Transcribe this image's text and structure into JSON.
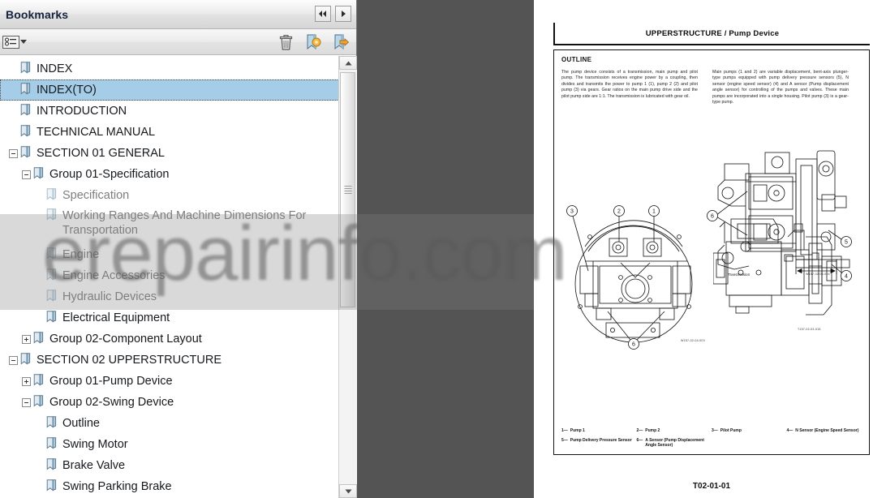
{
  "panel": {
    "title": "Bookmarks",
    "nav": {
      "prev_label": "◀◀",
      "next_label": "▶"
    },
    "toolbar": {
      "options_label": "Options",
      "delete_label": "Delete",
      "new_bookmark_label": "New Bookmark",
      "goto_bookmark_label": "Go To Bookmark"
    }
  },
  "tree": {
    "items": [
      {
        "label": "INDEX",
        "level": 0,
        "expander": "none",
        "state": "normal"
      },
      {
        "label": "INDEX(TO)",
        "level": 0,
        "expander": "none",
        "state": "selected"
      },
      {
        "label": "INTRODUCTION",
        "level": 0,
        "expander": "none",
        "state": "normal"
      },
      {
        "label": "TECHNICAL MANUAL",
        "level": 0,
        "expander": "none",
        "state": "normal"
      },
      {
        "label": "SECTION 01 GENERAL",
        "level": 0,
        "expander": "minus",
        "state": "normal"
      },
      {
        "label": "Group 01-Specification",
        "level": 1,
        "expander": "minus",
        "state": "normal"
      },
      {
        "label": "Specification",
        "level": 2,
        "expander": "none",
        "state": "dim"
      },
      {
        "label": "Working Ranges And Machine Dimensions For Transportation",
        "level": 2,
        "expander": "none",
        "state": "dim",
        "wrap": true
      },
      {
        "label": "Engine",
        "level": 2,
        "expander": "none",
        "state": "dim"
      },
      {
        "label": "Engine Accessories",
        "level": 2,
        "expander": "none",
        "state": "dim"
      },
      {
        "label": "Hydraulic Devices",
        "level": 2,
        "expander": "none",
        "state": "dim"
      },
      {
        "label": "Electrical Equipment",
        "level": 2,
        "expander": "none",
        "state": "normal"
      },
      {
        "label": "Group 02-Component Layout",
        "level": 1,
        "expander": "plus",
        "state": "normal"
      },
      {
        "label": "SECTION 02 UPPERSTRUCTURE",
        "level": 0,
        "expander": "minus",
        "state": "normal"
      },
      {
        "label": "Group 01-Pump Device",
        "level": 1,
        "expander": "plus",
        "state": "normal"
      },
      {
        "label": "Group 02-Swing Device",
        "level": 1,
        "expander": "minus",
        "state": "normal"
      },
      {
        "label": "Outline",
        "level": 2,
        "expander": "none",
        "state": "normal"
      },
      {
        "label": "Swing Motor",
        "level": 2,
        "expander": "none",
        "state": "normal"
      },
      {
        "label": "Brake Valve",
        "level": 2,
        "expander": "none",
        "state": "normal"
      },
      {
        "label": "Swing Parking Brake",
        "level": 2,
        "expander": "none",
        "state": "normal"
      }
    ]
  },
  "document": {
    "header_title": "UPPERSTRUCTURE / Pump Device",
    "section_heading": "OUTLINE",
    "column_left": "The pump device consists of a transmission, main pump and pilot pump. The transmission receives engine power by a coupling, then divides and transmits the power to pump 1 (1), pump 2 (2) and pilot pump (3) via gears. Gear ratios on the main pump drive side and the pilot pump side are 1:1. The transmission is lubricated with gear oil.",
    "column_right": "Main pumps (1 and 2) are variable displacement, bent-axis plunger-type pumps equipped with pump delivery pressure sensors (5), N sensor (engine speed sensor) (4) and A sensor (Pump displacement angle sensor) for controlling of the pumps and valves. These main pumps are incorporated into a single housing. Pilot pump (3) is a gear-type pump.",
    "figure_codes": {
      "top_right": "W157-02-04-004",
      "bottom_left": "W157-02-04-003",
      "bottom_right": "T157-02-03-015"
    },
    "figure_labels": {
      "transmission": "Transmission"
    },
    "callouts": [
      "1",
      "2",
      "3",
      "4",
      "5",
      "6"
    ],
    "legend": [
      {
        "num": "1—",
        "text": "Pump 1"
      },
      {
        "num": "2—",
        "text": "Pump 2"
      },
      {
        "num": "3—",
        "text": "Pilot Pump"
      },
      {
        "num": "4—",
        "text": "N Sensor (Engine Speed Sensor)"
      },
      {
        "num": "5—",
        "text": "Pump Delivery Pressure Sensor"
      },
      {
        "num": "6—",
        "text": "A Sensor (Pump Displacement Angle Sensor)"
      }
    ],
    "page_code": "T02-01-01"
  },
  "watermark": {
    "text": "erepairinfo.com"
  },
  "colors": {
    "selection": "#a5cde8",
    "viewer_background": "#545454",
    "page": "#ffffff",
    "title_text": "#16213c",
    "dim_text": "#7d7d7d"
  }
}
